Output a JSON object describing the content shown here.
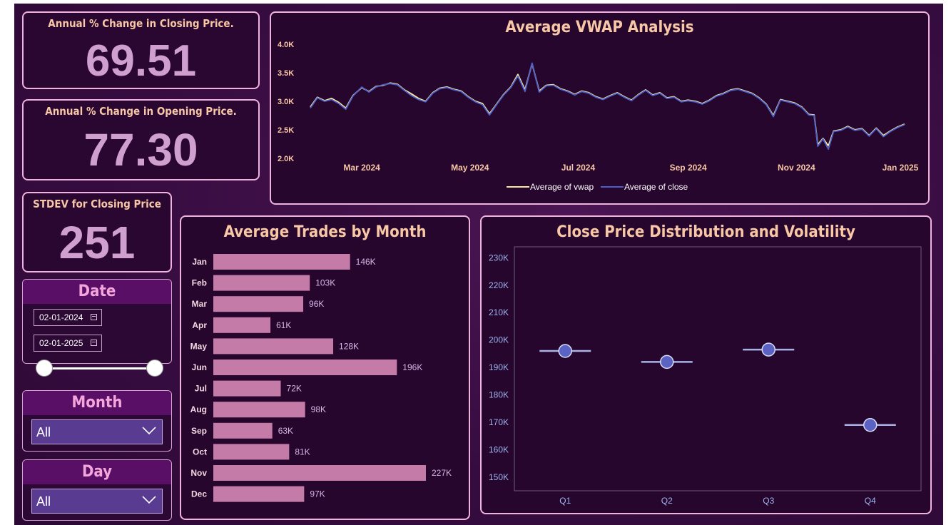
{
  "kpis": {
    "close_change": {
      "title": "Annual % Change in Closing Price.",
      "value": "69.51"
    },
    "open_change": {
      "title": "Annual % Change in Opening Price.",
      "value": "77.30"
    },
    "stdev_close": {
      "title": "STDEV for Closing Price",
      "value": "251"
    }
  },
  "slicers": {
    "date": {
      "title": "Date",
      "start": "02-01-2024",
      "end": "02-01-2025"
    },
    "month": {
      "title": "Month",
      "selected": "All"
    },
    "day": {
      "title": "Day",
      "selected": "All"
    }
  },
  "icons": {
    "calendar": "calendar-icon",
    "dropdown": "chevron-down-icon"
  },
  "colors": {
    "accent_pink": "#f0b3de",
    "title_peach": "#f8c7a6",
    "bar": "#c47ba8",
    "vwap_line": "#f5e7a0",
    "close_line": "#4d5fc9",
    "marker": "#5a62c4"
  },
  "chart_data": [
    {
      "id": "vwap",
      "type": "line",
      "title": "Average VWAP Analysis",
      "x_ticks": [
        "Mar 2024",
        "May 2024",
        "Jul 2024",
        "Sep 2024",
        "Nov 2024",
        "Jan 2025"
      ],
      "y_ticks": [
        "4.0K",
        "3.5K",
        "3.0K",
        "2.5K",
        "2.0K"
      ],
      "ylim": [
        2000,
        4000
      ],
      "x_range": [
        "2024-02-01",
        "2025-01-01"
      ],
      "legend_position": "bottom-center",
      "series": [
        {
          "name": "Average of vwap",
          "color": "#f5e7a0",
          "points": [
            [
              "2024-02-01",
              2900
            ],
            [
              "2024-02-05",
              3070
            ],
            [
              "2024-02-09",
              3010
            ],
            [
              "2024-02-13",
              3050
            ],
            [
              "2024-02-17",
              2980
            ],
            [
              "2024-02-21",
              2880
            ],
            [
              "2024-02-25",
              3100
            ],
            [
              "2024-03-01",
              3240
            ],
            [
              "2024-03-05",
              3170
            ],
            [
              "2024-03-09",
              3260
            ],
            [
              "2024-03-13",
              3280
            ],
            [
              "2024-03-17",
              3320
            ],
            [
              "2024-03-21",
              3300
            ],
            [
              "2024-03-25",
              3200
            ],
            [
              "2024-03-29",
              3130
            ],
            [
              "2024-04-02",
              3050
            ],
            [
              "2024-04-06",
              3000
            ],
            [
              "2024-04-10",
              3150
            ],
            [
              "2024-04-14",
              3230
            ],
            [
              "2024-04-18",
              3250
            ],
            [
              "2024-04-22",
              3210
            ],
            [
              "2024-04-26",
              3180
            ],
            [
              "2024-04-30",
              3080
            ],
            [
              "2024-05-04",
              3000
            ],
            [
              "2024-05-08",
              2960
            ],
            [
              "2024-05-12",
              2780
            ],
            [
              "2024-05-16",
              2950
            ],
            [
              "2024-05-20",
              3120
            ],
            [
              "2024-05-24",
              3250
            ],
            [
              "2024-05-28",
              3470
            ],
            [
              "2024-06-01",
              3200
            ],
            [
              "2024-06-05",
              3660
            ],
            [
              "2024-06-09",
              3180
            ],
            [
              "2024-06-13",
              3280
            ],
            [
              "2024-06-17",
              3290
            ],
            [
              "2024-06-21",
              3220
            ],
            [
              "2024-06-25",
              3180
            ],
            [
              "2024-06-29",
              3120
            ],
            [
              "2024-07-03",
              3180
            ],
            [
              "2024-07-07",
              3150
            ],
            [
              "2024-07-11",
              3080
            ],
            [
              "2024-07-15",
              3040
            ],
            [
              "2024-07-19",
              3100
            ],
            [
              "2024-07-23",
              3150
            ],
            [
              "2024-07-27",
              3080
            ],
            [
              "2024-07-31",
              3020
            ],
            [
              "2024-08-04",
              3120
            ],
            [
              "2024-08-08",
              3200
            ],
            [
              "2024-08-12",
              3110
            ],
            [
              "2024-08-16",
              3150
            ],
            [
              "2024-08-20",
              3060
            ],
            [
              "2024-08-24",
              3080
            ],
            [
              "2024-08-28",
              3000
            ],
            [
              "2024-09-01",
              3020
            ],
            [
              "2024-09-05",
              3000
            ],
            [
              "2024-09-09",
              2960
            ],
            [
              "2024-09-13",
              3020
            ],
            [
              "2024-09-17",
              3100
            ],
            [
              "2024-09-21",
              3140
            ],
            [
              "2024-09-25",
              3200
            ],
            [
              "2024-09-29",
              3220
            ],
            [
              "2024-10-03",
              3180
            ],
            [
              "2024-10-07",
              3140
            ],
            [
              "2024-10-11",
              3060
            ],
            [
              "2024-10-15",
              2950
            ],
            [
              "2024-10-19",
              2750
            ],
            [
              "2024-10-23",
              3030
            ],
            [
              "2024-10-27",
              3000
            ],
            [
              "2024-10-31",
              2970
            ],
            [
              "2024-11-04",
              2900
            ],
            [
              "2024-11-08",
              2770
            ],
            [
              "2024-11-11",
              2760
            ],
            [
              "2024-11-13",
              2240
            ],
            [
              "2024-11-16",
              2350
            ],
            [
              "2024-11-19",
              2220
            ],
            [
              "2024-11-22",
              2480
            ],
            [
              "2024-11-26",
              2500
            ],
            [
              "2024-11-30",
              2560
            ],
            [
              "2024-12-04",
              2500
            ],
            [
              "2024-12-08",
              2520
            ],
            [
              "2024-12-12",
              2400
            ],
            [
              "2024-12-16",
              2530
            ],
            [
              "2024-12-20",
              2400
            ],
            [
              "2024-12-24",
              2480
            ],
            [
              "2024-12-28",
              2550
            ],
            [
              "2025-01-01",
              2600
            ]
          ]
        },
        {
          "name": "Average of close",
          "color": "#4d5fc9",
          "points": [
            [
              "2024-02-01",
              2880
            ],
            [
              "2024-02-05",
              3060
            ],
            [
              "2024-02-09",
              3000
            ],
            [
              "2024-02-13",
              3030
            ],
            [
              "2024-02-17",
              2960
            ],
            [
              "2024-02-21",
              2860
            ],
            [
              "2024-02-25",
              3090
            ],
            [
              "2024-03-01",
              3250
            ],
            [
              "2024-03-05",
              3160
            ],
            [
              "2024-03-09",
              3250
            ],
            [
              "2024-03-13",
              3290
            ],
            [
              "2024-03-17",
              3310
            ],
            [
              "2024-03-21",
              3290
            ],
            [
              "2024-03-25",
              3190
            ],
            [
              "2024-03-29",
              3100
            ],
            [
              "2024-04-02",
              3030
            ],
            [
              "2024-04-06",
              2990
            ],
            [
              "2024-04-10",
              3140
            ],
            [
              "2024-04-14",
              3220
            ],
            [
              "2024-04-18",
              3240
            ],
            [
              "2024-04-22",
              3200
            ],
            [
              "2024-04-26",
              3170
            ],
            [
              "2024-04-30",
              3070
            ],
            [
              "2024-05-04",
              2990
            ],
            [
              "2024-05-08",
              2940
            ],
            [
              "2024-05-12",
              2760
            ],
            [
              "2024-05-16",
              2940
            ],
            [
              "2024-05-20",
              3110
            ],
            [
              "2024-05-24",
              3240
            ],
            [
              "2024-05-28",
              3440
            ],
            [
              "2024-06-01",
              3170
            ],
            [
              "2024-06-05",
              3670
            ],
            [
              "2024-06-09",
              3160
            ],
            [
              "2024-06-13",
              3270
            ],
            [
              "2024-06-17",
              3280
            ],
            [
              "2024-06-21",
              3210
            ],
            [
              "2024-06-25",
              3170
            ],
            [
              "2024-06-29",
              3110
            ],
            [
              "2024-07-03",
              3170
            ],
            [
              "2024-07-07",
              3140
            ],
            [
              "2024-07-11",
              3070
            ],
            [
              "2024-07-15",
              3030
            ],
            [
              "2024-07-19",
              3090
            ],
            [
              "2024-07-23",
              3140
            ],
            [
              "2024-07-27",
              3070
            ],
            [
              "2024-07-31",
              3010
            ],
            [
              "2024-08-04",
              3110
            ],
            [
              "2024-08-08",
              3190
            ],
            [
              "2024-08-12",
              3100
            ],
            [
              "2024-08-16",
              3140
            ],
            [
              "2024-08-20",
              3050
            ],
            [
              "2024-08-24",
              3070
            ],
            [
              "2024-08-28",
              2990
            ],
            [
              "2024-09-01",
              3010
            ],
            [
              "2024-09-05",
              2990
            ],
            [
              "2024-09-09",
              2950
            ],
            [
              "2024-09-13",
              3010
            ],
            [
              "2024-09-17",
              3090
            ],
            [
              "2024-09-21",
              3130
            ],
            [
              "2024-09-25",
              3190
            ],
            [
              "2024-09-29",
              3210
            ],
            [
              "2024-10-03",
              3170
            ],
            [
              "2024-10-07",
              3130
            ],
            [
              "2024-10-11",
              3050
            ],
            [
              "2024-10-15",
              2940
            ],
            [
              "2024-10-19",
              2730
            ],
            [
              "2024-10-23",
              3020
            ],
            [
              "2024-10-27",
              2990
            ],
            [
              "2024-10-31",
              2960
            ],
            [
              "2024-11-04",
              2890
            ],
            [
              "2024-11-08",
              2760
            ],
            [
              "2024-11-11",
              2750
            ],
            [
              "2024-11-13",
              2210
            ],
            [
              "2024-11-16",
              2340
            ],
            [
              "2024-11-19",
              2160
            ],
            [
              "2024-11-22",
              2470
            ],
            [
              "2024-11-26",
              2490
            ],
            [
              "2024-11-30",
              2550
            ],
            [
              "2024-12-04",
              2490
            ],
            [
              "2024-12-08",
              2510
            ],
            [
              "2024-12-12",
              2390
            ],
            [
              "2024-12-16",
              2520
            ],
            [
              "2024-12-20",
              2380
            ],
            [
              "2024-12-24",
              2470
            ],
            [
              "2024-12-28",
              2540
            ],
            [
              "2025-01-01",
              2590
            ]
          ]
        }
      ]
    },
    {
      "id": "trades",
      "type": "bar",
      "orientation": "horizontal",
      "title": "Average Trades by Month",
      "categories": [
        "Jan",
        "Feb",
        "Mar",
        "Apr",
        "May",
        "Jun",
        "Jul",
        "Aug",
        "Sep",
        "Oct",
        "Nov",
        "Dec"
      ],
      "values": [
        146000,
        103000,
        96000,
        61000,
        128000,
        196000,
        72000,
        98000,
        63000,
        81000,
        227000,
        97000
      ],
      "labels": [
        "146K",
        "103K",
        "96K",
        "61K",
        "128K",
        "196K",
        "72K",
        "98K",
        "63K",
        "81K",
        "227K",
        "97K"
      ],
      "xlim": [
        0,
        227000
      ]
    },
    {
      "id": "volatility",
      "type": "scatter",
      "title": "Close Price Distribution and Volatility",
      "categories": [
        "Q1",
        "Q2",
        "Q3",
        "Q4"
      ],
      "values": [
        196000,
        192000,
        196500,
        169000
      ],
      "y_ticks": [
        "230K",
        "220K",
        "210K",
        "200K",
        "190K",
        "180K",
        "170K",
        "160K",
        "150K"
      ],
      "ylim": [
        145000,
        234000
      ],
      "grid": false
    }
  ]
}
